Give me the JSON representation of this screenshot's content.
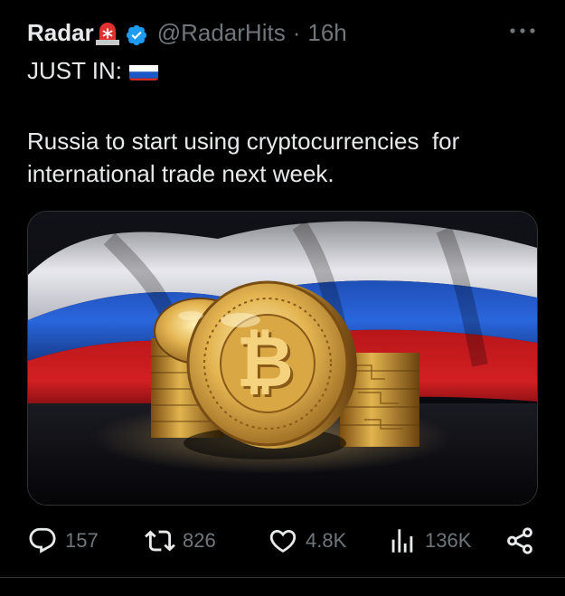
{
  "tweet": {
    "display_name": "Radar",
    "handle": "@RadarHits",
    "separator": "·",
    "time": "16h",
    "header_line": "JUST IN:",
    "body": "Russia to start using cryptocurrencies  for international trade next week.",
    "media_icon": "bitcoin-coins-on-russian-flag-image",
    "flag_icon": "russian-flag-emoji",
    "siren_icon": "police-siren-emoji"
  },
  "actions": {
    "replies": "157",
    "retweets": "826",
    "likes": "4.8K",
    "views": "136K"
  },
  "colors": {
    "background": "#000000",
    "text_primary": "#e7e9ea",
    "text_secondary": "#71767b",
    "verified_blue": "#1d9bf0",
    "border": "#2f3336"
  }
}
